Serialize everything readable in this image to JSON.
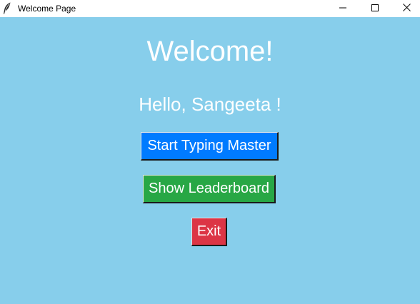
{
  "window": {
    "title": "Welcome Page",
    "background": "#87ceeb",
    "controls": {
      "minimize_icon": "minimize-icon",
      "maximize_icon": "maximize-icon",
      "close_icon": "close-icon"
    },
    "app_icon": "feather-icon"
  },
  "main": {
    "heading": "Welcome!",
    "greeting": "Hello, Sangeeta !",
    "text_color": "#ffffff"
  },
  "buttons": {
    "start": {
      "label": "Start Typing Master",
      "color": "#007bff"
    },
    "leaderboard": {
      "label": "Show Leaderboard",
      "color": "#28a745"
    },
    "exit": {
      "label": "Exit",
      "color": "#dc3545"
    }
  }
}
